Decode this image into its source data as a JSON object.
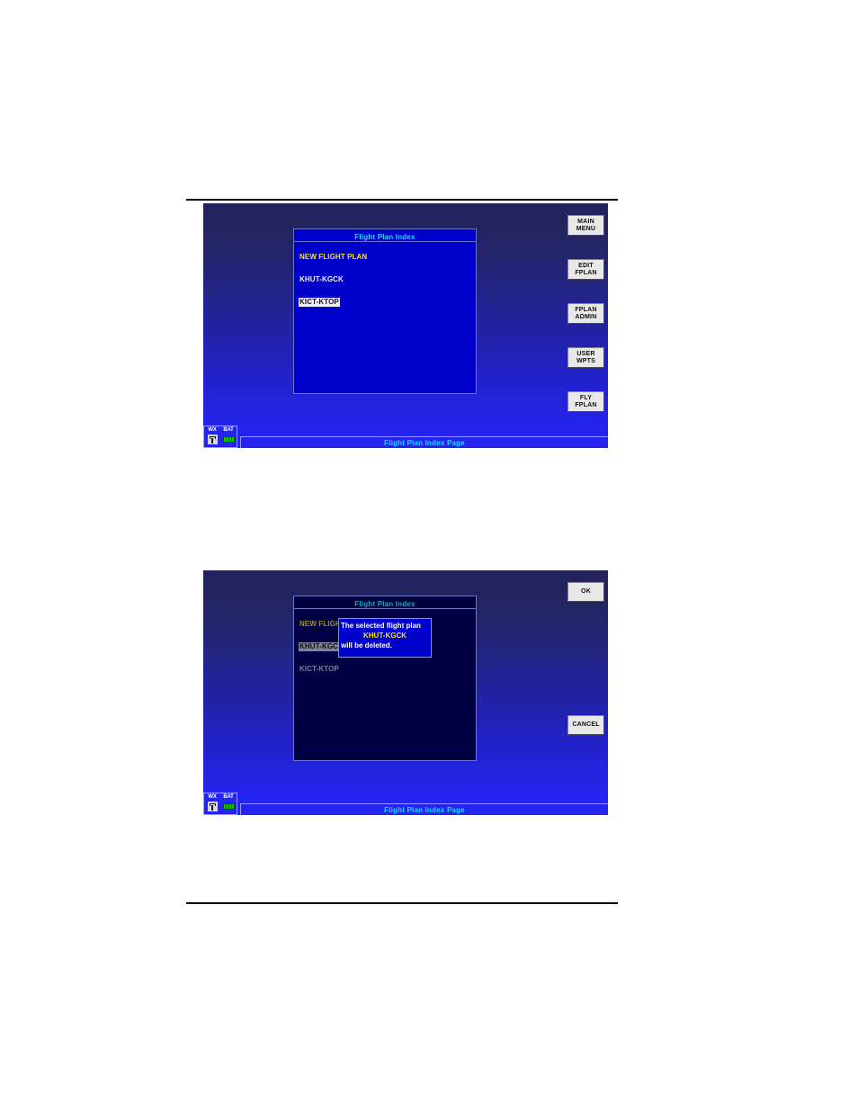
{
  "document": {
    "rules": [
      "top-rule",
      "bottom-rule"
    ]
  },
  "screens": [
    {
      "id": "flight-plan-index",
      "panel": {
        "title": "Flight Plan Index",
        "items": [
          {
            "label": "NEW FLIGHT PLAN",
            "state": "new"
          },
          {
            "label": "KHUT-KGCK",
            "state": "normal"
          },
          {
            "label": "KICT-KTOP",
            "state": "selected"
          }
        ]
      },
      "softkeys": [
        {
          "line1": "MAIN",
          "line2": "MENU"
        },
        {
          "line1": "EDIT",
          "line2": "FPLAN"
        },
        {
          "line1": "FPLAN",
          "line2": "ADMIN"
        },
        {
          "line1": "USER",
          "line2": "WPTS"
        },
        {
          "line1": "FLY",
          "line2": "FPLAN"
        }
      ],
      "status": {
        "wx_label": "WX",
        "bat_label": "BAT",
        "footer": "Flight Plan Index Page"
      }
    },
    {
      "id": "flight-plan-delete-confirm",
      "panel": {
        "title": "Flight Plan Index",
        "items": [
          {
            "label": "NEW FLIGHT PLAN",
            "state": "new"
          },
          {
            "label": "KHUT-KGCK",
            "state": "selected"
          },
          {
            "label": "KICT-KTOP",
            "state": "normal"
          }
        ]
      },
      "dialog": {
        "line1": "The selected flight plan",
        "line2": "KHUT-KGCK",
        "line3": "will be deleted."
      },
      "softkeys": [
        {
          "line1": "OK"
        },
        {
          "line1": "CANCEL"
        }
      ],
      "status": {
        "wx_label": "WX",
        "bat_label": "BAT",
        "footer": "Flight Plan Index Page"
      }
    }
  ],
  "colors": {
    "panel_bright": "#0000cd",
    "panel_dim": "#000044",
    "title_cyan": "#15e0ff",
    "new_yellow": "#ffe400",
    "screen_top": "#23245e",
    "screen_bottom": "#2424ee"
  }
}
